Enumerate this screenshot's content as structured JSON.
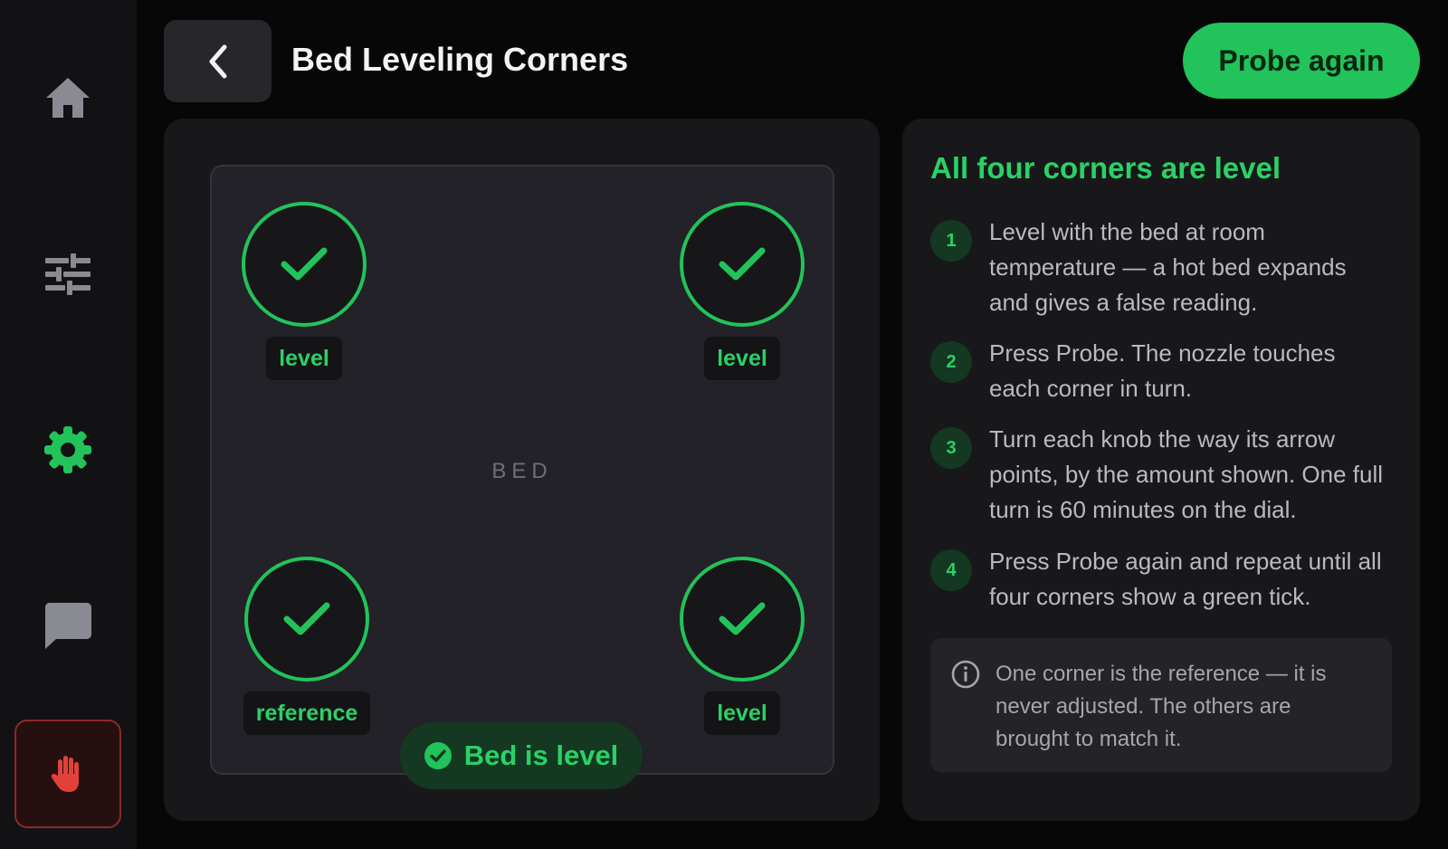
{
  "colors": {
    "accent": "#22c35a",
    "accent_text": "#2ad166",
    "danger": "#e2413a",
    "icon_inactive": "#8a8a92"
  },
  "sidebar": {
    "items": [
      {
        "icon": "home-icon",
        "active": false
      },
      {
        "icon": "sliders-icon",
        "active": false
      },
      {
        "icon": "gear-icon",
        "active": true
      },
      {
        "icon": "chat-icon",
        "active": false
      },
      {
        "icon": "hand-stop-icon",
        "active": false,
        "variant": "emergency-stop"
      }
    ]
  },
  "header": {
    "back_icon": "chevron-left-icon",
    "title": "Bed Leveling Corners",
    "probe_label": "Probe again"
  },
  "bed": {
    "label": "BED",
    "corners": [
      {
        "position": "top-left",
        "status": "level",
        "icon": "check-icon"
      },
      {
        "position": "top-right",
        "status": "level",
        "icon": "check-icon"
      },
      {
        "position": "bottom-left",
        "status": "reference",
        "icon": "check-icon"
      },
      {
        "position": "bottom-right",
        "status": "level",
        "icon": "check-icon"
      }
    ],
    "status_text": "Bed is level",
    "status_icon": "check-circle-icon"
  },
  "instructions": {
    "title": "All four corners are level",
    "steps": [
      {
        "number": "1",
        "text": "Level with the bed at room temperature — a hot bed expands and gives a false reading."
      },
      {
        "number": "2",
        "text": "Press Probe. The nozzle touches each corner in turn."
      },
      {
        "number": "3",
        "text": "Turn each knob the way its arrow points, by the amount shown. One full turn is 60 minutes on the dial."
      },
      {
        "number": "4",
        "text": "Press Probe again and repeat until all four corners show a green tick."
      }
    ],
    "note_icon": "info-icon",
    "note": "One corner is the reference — it is never adjusted. The others are brought to match it."
  }
}
